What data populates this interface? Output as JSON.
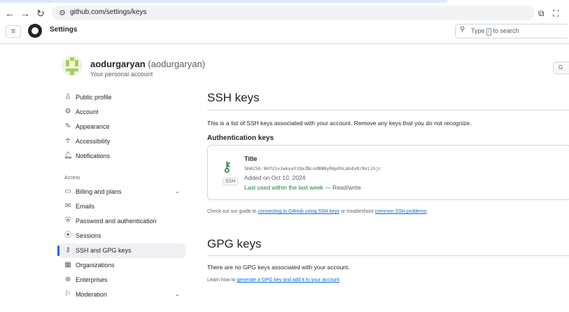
{
  "browser": {
    "url": "github.com/settings/keys"
  },
  "header": {
    "title": "Settings",
    "search_prefix": "Type",
    "search_key": "/",
    "search_suffix": "to search"
  },
  "account": {
    "name": "aodurgaryan",
    "handle": "(aodurgaryan)",
    "subtitle": "Your personal account",
    "edge_button": "G"
  },
  "sidebar": {
    "section_access": "Access",
    "items": [
      {
        "label": "Public profile",
        "icon": "person-icon"
      },
      {
        "label": "Account",
        "icon": "gear-icon"
      },
      {
        "label": "Appearance",
        "icon": "paintbrush-icon"
      },
      {
        "label": "Accessibility",
        "icon": "accessibility-icon"
      },
      {
        "label": "Notifications",
        "icon": "bell-icon"
      },
      {
        "label": "Billing and plans",
        "icon": "credit-card-icon"
      },
      {
        "label": "Emails",
        "icon": "mail-icon"
      },
      {
        "label": "Password and authentication",
        "icon": "shield-lock-icon"
      },
      {
        "label": "Sessions",
        "icon": "broadcast-icon"
      },
      {
        "label": "SSH and GPG keys",
        "icon": "key-icon"
      },
      {
        "label": "Organizations",
        "icon": "organization-icon"
      },
      {
        "label": "Enterprises",
        "icon": "globe-icon"
      },
      {
        "label": "Moderation",
        "icon": "report-icon"
      }
    ]
  },
  "main": {
    "title": "SSH keys",
    "description": "This is a list of SSH keys associated with your account. Remove any keys that you do not recognize.",
    "auth_heading": "Authentication keys",
    "key": {
      "title": "Title",
      "fingerprint": "SHA256:9H7U1vJwmxaYzQxZBcodNNByR6pOhLAUdxR/NxLihjc",
      "badge": "SSH",
      "added": "Added on Oct 10, 2024",
      "last_used": "Last used within the last week",
      "access": "— Read/write"
    },
    "guide": {
      "prefix": "Check out our guide to",
      "link1": "connecting to GitHub using SSH keys",
      "middle": "or troubleshoot",
      "link2": "common SSH problems",
      "suffix": "."
    },
    "gpg": {
      "title": "GPG keys",
      "empty": "There are no GPG keys associated with your account.",
      "learn_prefix": "Learn how to",
      "learn_link": "generate a GPG key and add it to your account",
      "learn_suffix": "."
    }
  },
  "colors": {
    "accent": "#0969da",
    "success": "#1a7f37",
    "active_bg": "#eef0f3"
  }
}
